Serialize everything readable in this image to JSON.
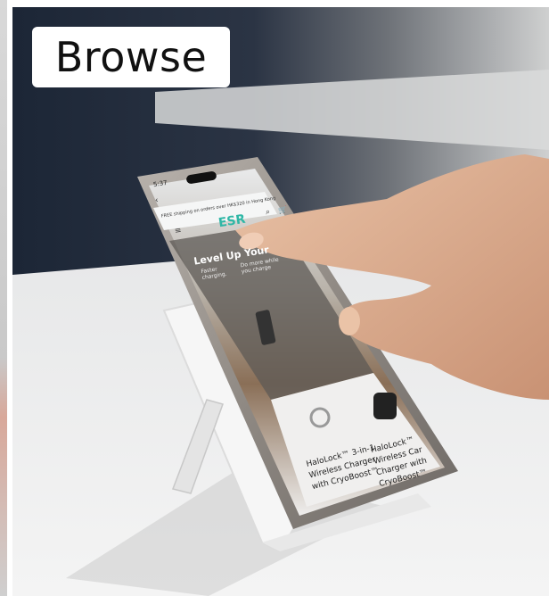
{
  "overlay": {
    "label": "Browse"
  },
  "phone_screen": {
    "status_time": "5:37",
    "banner": "FREE shipping on orders over HK$320 in Hong Kong",
    "logo": "ESR",
    "hero_title": "Level Up Your",
    "hero_sub_left": "Faster charging.",
    "hero_sub_right": "Do more while you charge",
    "product_1": "HaloLock™ 3-in-1 Wireless Charger with CryoBoost™",
    "product_2": "HaloLock™ Wireless Car Charger with CryoBoost™"
  },
  "colors": {
    "background_wall": "#1e2a3a",
    "table": "#e9e9e9",
    "phone_frame": "#9a9590",
    "stand": "#f2f2f2",
    "logo": "#2fb7a6"
  },
  "icons": [
    "back-icon",
    "menu-icon",
    "search-icon",
    "cart-icon"
  ]
}
